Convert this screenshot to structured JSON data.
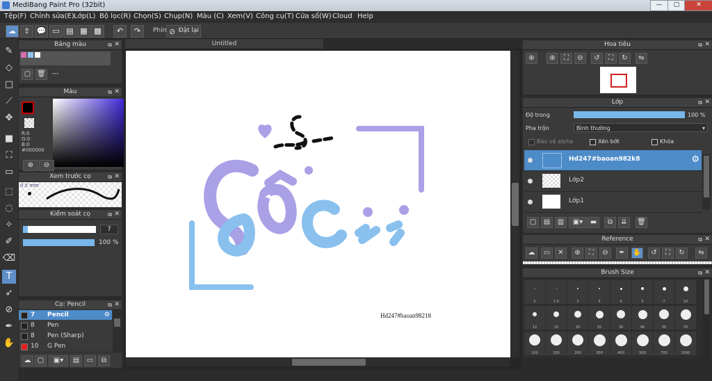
{
  "window": {
    "title": "MediBang Paint Pro (32bit)"
  },
  "menu": [
    "Tệp(F)",
    "Chỉnh sửa(E)",
    "Lớp(L)",
    "Bộ lọc(R)",
    "Chọn(S)",
    "Chụp(N)",
    "Màu (C)",
    "Xem(V)",
    "Công cụ(T)",
    "Cửa sổ(W)",
    "Cloud",
    "Help"
  ],
  "toolbar": {
    "label": "Phím",
    "reset": "Đặt lại"
  },
  "palette": {
    "title": "Bảng màu",
    "name": "---"
  },
  "color": {
    "title": "Màu",
    "r": "R:0",
    "g": "G:0",
    "b": "B:0",
    "hex": "#000000",
    "primary": "#000000",
    "accent": "#5e8fc9"
  },
  "brush_preview": {
    "title": "Xem trước cọ",
    "size": "0.5 mm"
  },
  "brush_control": {
    "title": "Kiểm soát cọ",
    "size_value": "7",
    "opacity_value": "100 %",
    "size_fraction": 0.07,
    "opacity_fraction": 1.0
  },
  "brush_list": {
    "title": "Cọ: Pencil",
    "items": [
      {
        "size": "7",
        "name": "Pencil",
        "color": "#222222",
        "selected": true
      },
      {
        "size": "8",
        "name": "Pen",
        "color": "#222222",
        "selected": false
      },
      {
        "size": "8",
        "name": "Pen (Sharp)",
        "color": "#222222",
        "selected": false
      },
      {
        "size": "10",
        "name": "G Pen",
        "color": "#e02020",
        "selected": false
      }
    ]
  },
  "document": {
    "tab": "Untitled",
    "watermark": "Hd247#baoan98218"
  },
  "navigator": {
    "title": "Hoa tiêu"
  },
  "layers": {
    "title": "Lớp",
    "opacity_label": "Độ trong",
    "opacity_value": "100 %",
    "opacity_fraction": 1.0,
    "blend_label": "Pha trộn",
    "blend_value": "Bình thường",
    "alpha_label": "Bảo vệ alpha",
    "clip_label": "Xén bớt",
    "lock_label": "Khóa",
    "items": [
      {
        "name": "Hd247#baoan982k8",
        "selected": true
      },
      {
        "name": "Lớp2",
        "selected": false
      },
      {
        "name": "Lớp1",
        "selected": false
      }
    ]
  },
  "reference": {
    "title": "Reference"
  },
  "brush_size": {
    "title": "Brush Size",
    "sizes": [
      "1",
      "1.5",
      "2",
      "3",
      "4",
      "5",
      "7",
      "10",
      "12",
      "15",
      "20",
      "25",
      "30",
      "40",
      "50",
      "70",
      "100",
      "150",
      "200",
      "300",
      "400",
      "500",
      "700",
      "1000"
    ]
  }
}
